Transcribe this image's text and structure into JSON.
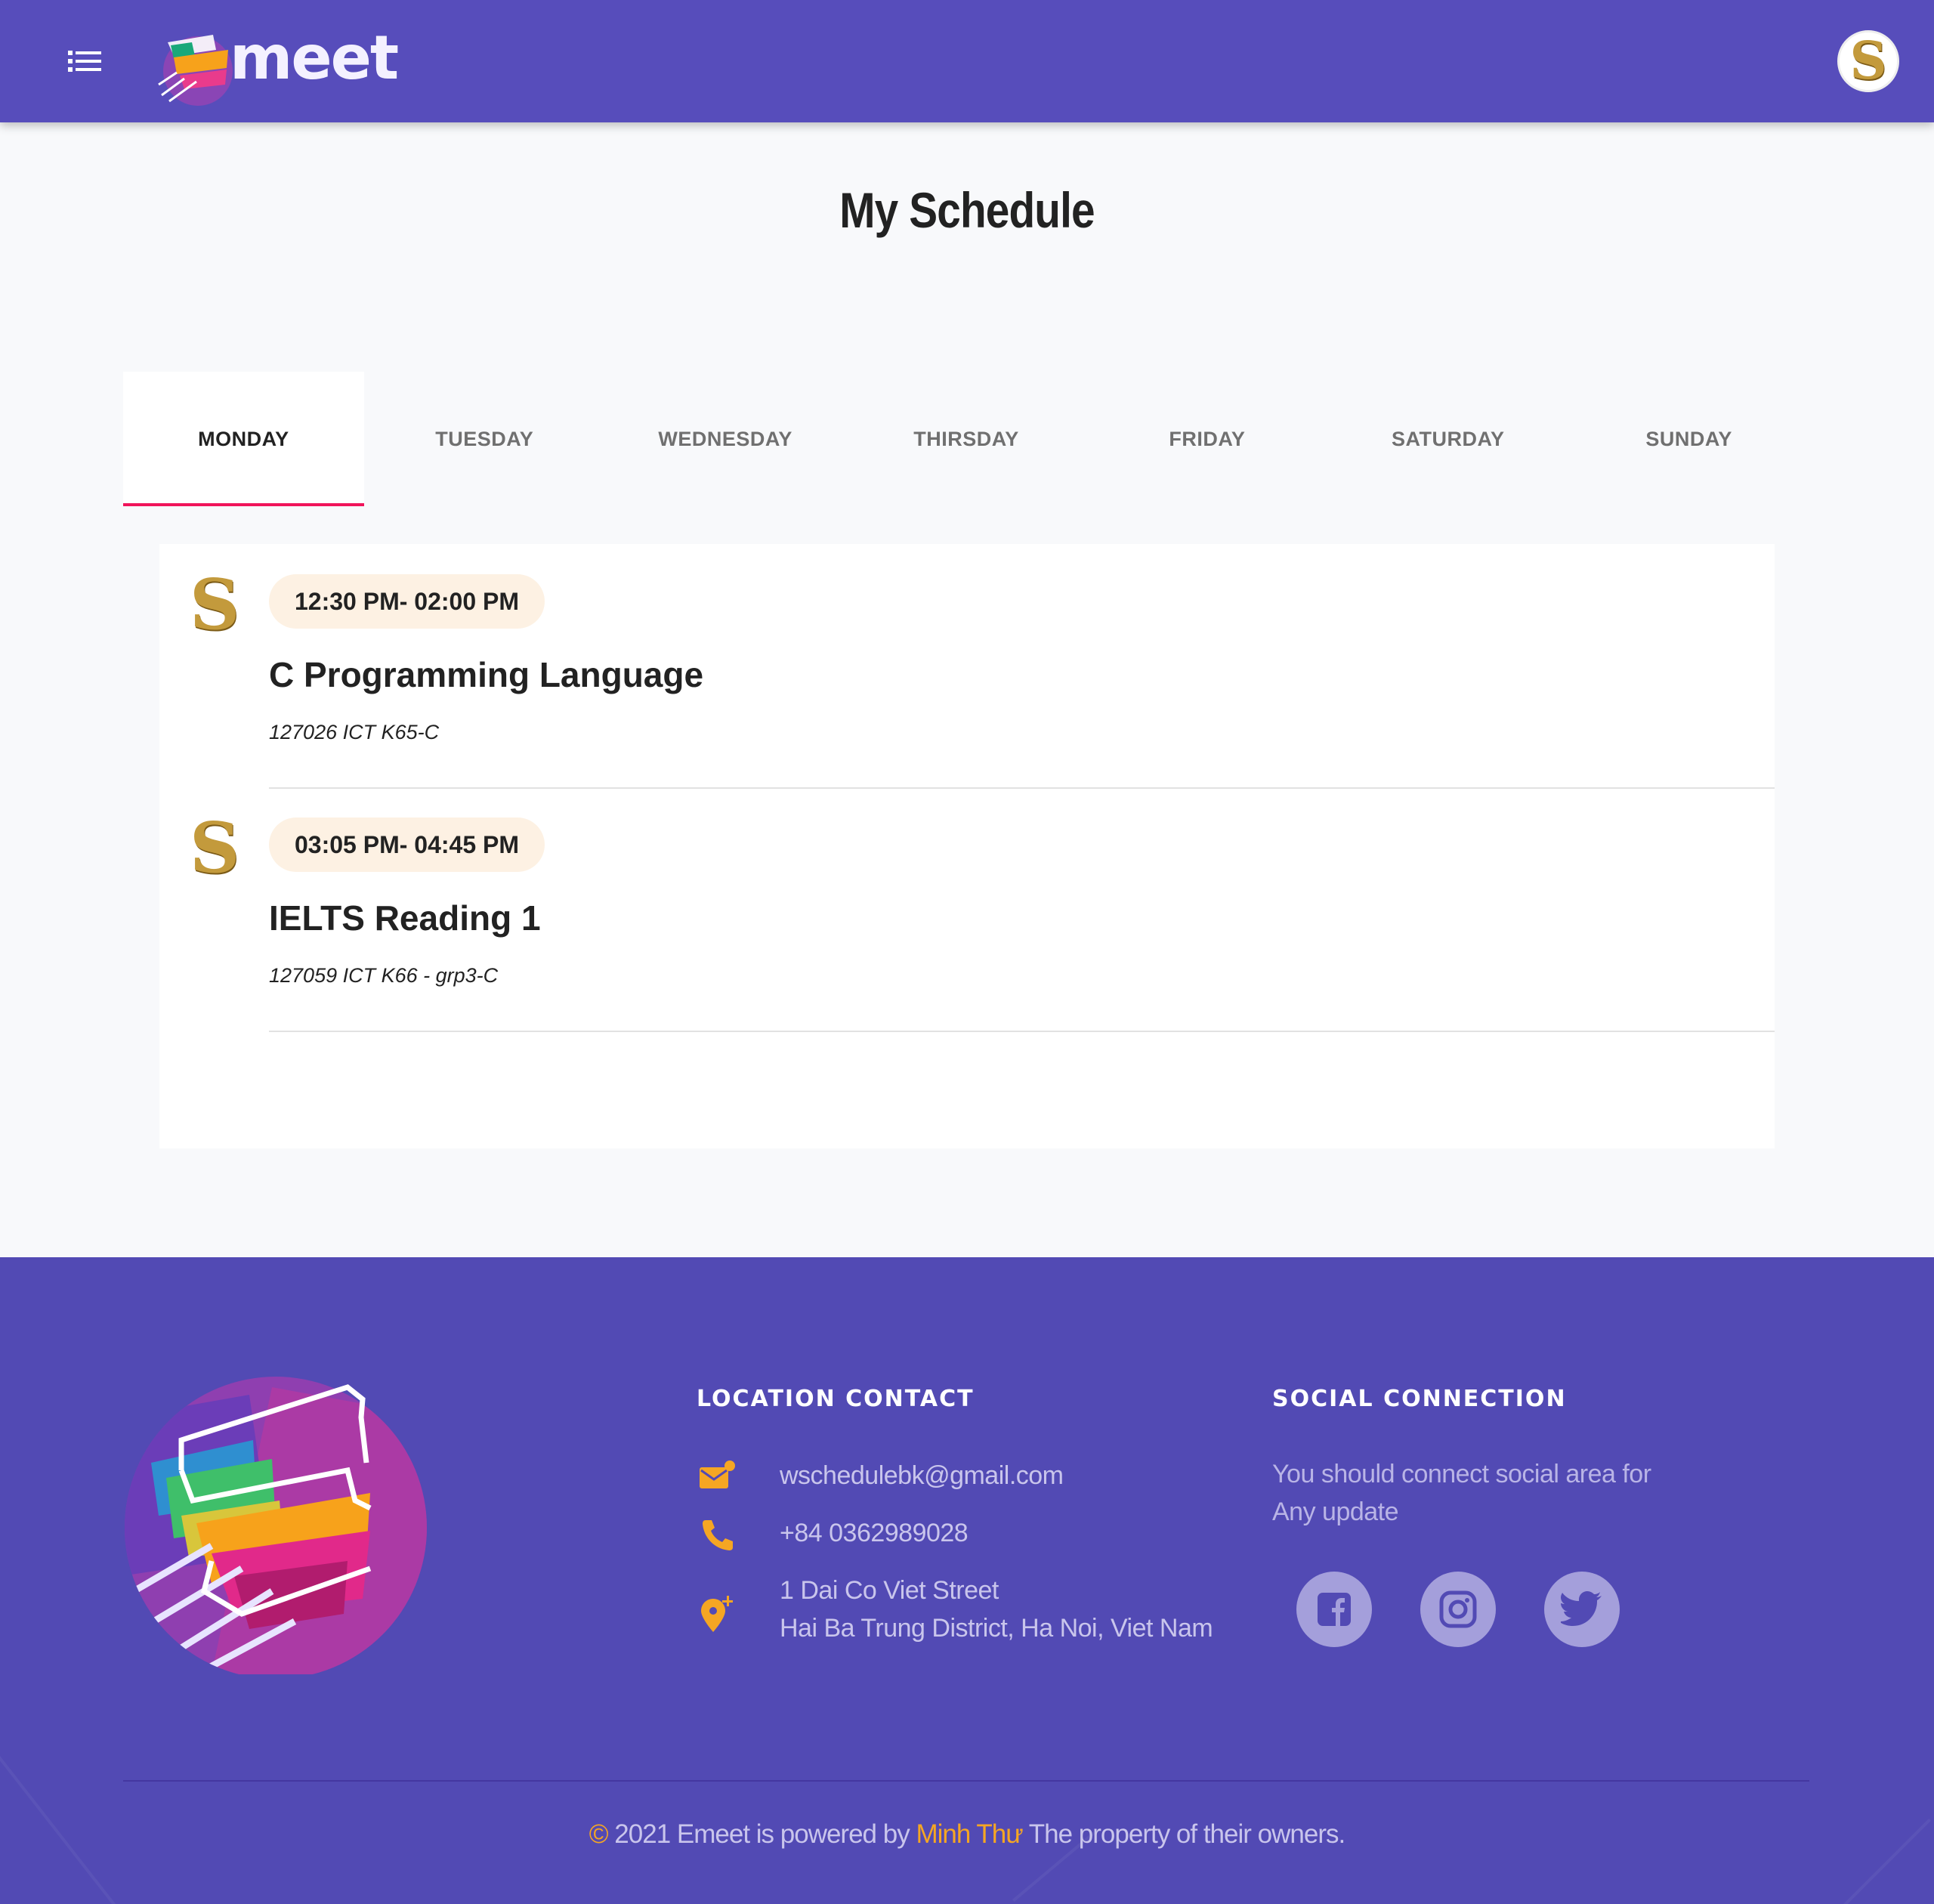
{
  "header": {
    "logo_text": "meet"
  },
  "page_title": "My Schedule",
  "tabs": [
    {
      "label": "MONDAY",
      "active": true
    },
    {
      "label": "TUESDAY",
      "active": false
    },
    {
      "label": "WEDNESDAY",
      "active": false
    },
    {
      "label": "THIRSDAY",
      "active": false
    },
    {
      "label": "FRIDAY",
      "active": false
    },
    {
      "label": "SATURDAY",
      "active": false
    },
    {
      "label": "SUNDAY",
      "active": false
    }
  ],
  "schedule": [
    {
      "time": "12:30 PM- 02:00 PM",
      "title": "C Programming Language",
      "code": "127026 ICT K65-C"
    },
    {
      "time": "03:05 PM- 04:45 PM",
      "title": "IELTS Reading 1",
      "code": "127059 ICT K66 - grp3-C"
    }
  ],
  "footer": {
    "location_title": "LOCATION CONTACT",
    "email": "wschedulebk@gmail.com",
    "phone": "+84 0362989028",
    "address_line1": "1 Dai Co Viet Street",
    "address_line2": "Hai Ba Trung District, Ha Noi, Viet Nam",
    "social_title": "SOCIAL CONNECTION",
    "social_text": "You should connect social area for Any update",
    "copyright_prefix": "© ",
    "copyright_main": "2021 Emeet is powered by ",
    "copyright_name": "Minh Thư",
    "copyright_suffix": " The property of their owners."
  },
  "icons": {
    "menu": "menu-list-icon",
    "avatar": "S",
    "email": "mail-icon",
    "phone": "phone-icon",
    "location": "location-pin-icon",
    "facebook": "facebook-icon",
    "instagram": "instagram-icon",
    "twitter": "twitter-icon"
  },
  "colors": {
    "header_bg": "#574dbb",
    "footer_bg": "#524ab4",
    "tab_active_underline": "#f0145a",
    "accent_orange": "#f5a623",
    "time_pill_bg": "#fdf1e3",
    "schedule_logo_gold": "#c39a3c"
  }
}
